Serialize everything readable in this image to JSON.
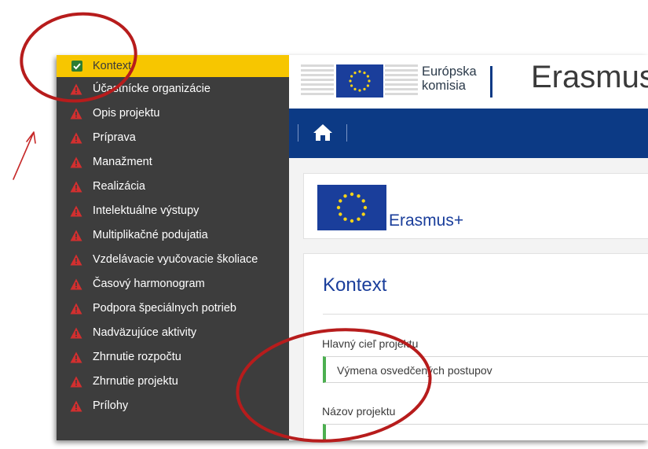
{
  "sidebar": {
    "items": [
      {
        "label": "Kontext",
        "status": "complete"
      },
      {
        "label": "Účastnícke organizácie",
        "status": "warning"
      },
      {
        "label": "Opis projektu",
        "status": "warning"
      },
      {
        "label": "Príprava",
        "status": "warning"
      },
      {
        "label": "Manažment",
        "status": "warning"
      },
      {
        "label": "Realizácia",
        "status": "warning"
      },
      {
        "label": "Intelektuálne výstupy",
        "status": "warning"
      },
      {
        "label": "Multiplikačné podujatia",
        "status": "warning"
      },
      {
        "label": "Vzdelávacie vyučovacie školiace",
        "status": "warning"
      },
      {
        "label": "Časový harmonogram",
        "status": "warning"
      },
      {
        "label": "Podpora špeciálnych potrieb",
        "status": "warning"
      },
      {
        "label": "Nadväzujúce aktivity",
        "status": "warning"
      },
      {
        "label": "Zhrnutie rozpočtu",
        "status": "warning"
      },
      {
        "label": "Zhrnutie projektu",
        "status": "warning"
      },
      {
        "label": "Prílohy",
        "status": "warning"
      }
    ]
  },
  "header": {
    "commission_line1": "Európska",
    "commission_line2": "komisia",
    "app_title": "Erasmus"
  },
  "brand_panel": {
    "title": "Erasmus+"
  },
  "main": {
    "section_title": "Kontext",
    "fields": [
      {
        "label": "Hlavný cieľ projektu",
        "value": "Výmena osvedčených postupov"
      },
      {
        "label": "Názov projektu",
        "value": ""
      }
    ]
  },
  "colors": {
    "sidebar_bg": "#3d3d3d",
    "active_bg": "#f7c600",
    "warning": "#d32f2f",
    "nav_blue": "#0c3a85",
    "annotation_red": "#b71c1c"
  }
}
